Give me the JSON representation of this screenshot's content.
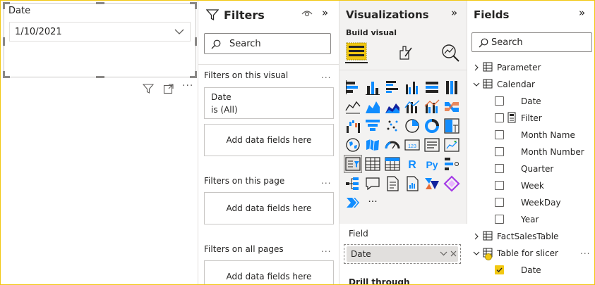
{
  "canvas": {
    "slicer": {
      "title": "Date",
      "selected_value": "1/10/2021"
    }
  },
  "filters_pane": {
    "title": "Filters",
    "search_placeholder": "Search",
    "on_visual": {
      "label": "Filters on this visual",
      "card_field": "Date",
      "card_state": "is (All)",
      "add_label": "Add data fields here"
    },
    "on_page": {
      "label": "Filters on this page",
      "add_label": "Add data fields here"
    },
    "all_pages": {
      "label": "Filters on all pages",
      "add_label": "Add data fields here"
    },
    "more_label": "..."
  },
  "viz_pane": {
    "title": "Visualizations",
    "build_label": "Build visual",
    "icons": [
      "stacked-bar",
      "stacked-column",
      "clustered-bar",
      "clustered-column",
      "100-stacked-bar",
      "100-stacked-column",
      "line",
      "area",
      "stacked-area",
      "line-stacked-column",
      "line-clustered-column",
      "ribbon",
      "waterfall",
      "funnel",
      "scatter",
      "pie",
      "donut",
      "treemap",
      "map",
      "filled-map",
      "gauge",
      "card",
      "multi-row-card",
      "kpi",
      "slicer",
      "table",
      "matrix",
      "r-visual",
      "python-visual",
      "key-influencers",
      "decomposition-tree",
      "qa",
      "smart-narrative",
      "paginated-report",
      "power-automate",
      "power-apps",
      "narrative-chevron",
      "more"
    ],
    "more_label": "···",
    "field_label": "Field",
    "field_value": "Date",
    "drill_label": "Drill through"
  },
  "fields_pane": {
    "title": "Fields",
    "search_placeholder": "Search",
    "tables": [
      {
        "name": "Parameter",
        "expanded": false
      },
      {
        "name": "Calendar",
        "expanded": true,
        "fields": [
          "Date",
          "Filter",
          "Month Name",
          "Month Number",
          "Quarter",
          "Week",
          "WeekDay",
          "Year"
        ]
      },
      {
        "name": "FactSalesTable",
        "expanded": false
      },
      {
        "name": "Table for slicer",
        "expanded": true,
        "fields": [
          "Date"
        ]
      }
    ],
    "more_label": "..."
  },
  "colors": {
    "accent": "#f2c811",
    "pane_bg": "#f3f2f1",
    "text": "#252423"
  }
}
